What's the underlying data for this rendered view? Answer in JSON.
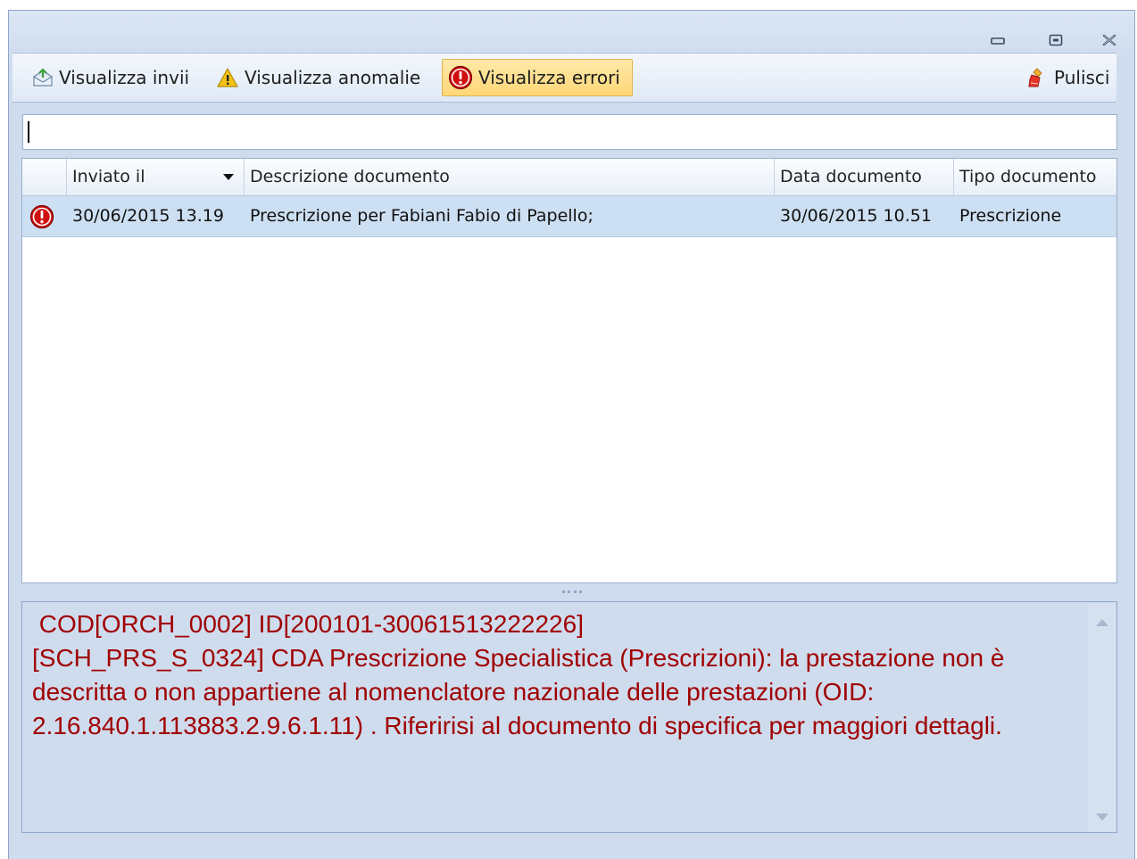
{
  "window": {
    "controls": {
      "minimize_icon": "minimize-icon",
      "restore_icon": "restore-icon",
      "close_icon": "close-icon"
    }
  },
  "toolbar": {
    "send_label": "Visualizza invii",
    "warnings_label": "Visualizza anomalie",
    "errors_label": "Visualizza errori",
    "clear_label": "Pulisci",
    "active": "errors"
  },
  "search": {
    "value": ""
  },
  "grid": {
    "columns": [
      "",
      "Inviato il",
      "Descrizione documento",
      "Data documento",
      "Tipo documento"
    ],
    "sort_column": "Inviato il",
    "rows": [
      {
        "status_icon": "error-icon",
        "sent": "30/06/2015 13.19",
        "description": "Prescrizione per Fabiani Fabio di Papello;",
        "doc_date": "30/06/2015 10.51",
        "doc_type": "Prescrizione"
      }
    ]
  },
  "details": {
    "text": " COD[ORCH_0002] ID[200101-30061513222226]\n[SCH_PRS_S_0324] CDA Prescrizione Specialistica (Prescrizioni): la prestazione non è descritta o non appartiene al nomenclatore nazionale delle prestazioni (OID: 2.16.840.1.113883.2.9.6.1.11) . Riferirisi al documento di specifica per maggiori dettagli."
  },
  "colors": {
    "error_red": "#d01010",
    "detail_text": "#a00000",
    "selected_row": "#cddff2",
    "active_button": "#ffd777"
  }
}
